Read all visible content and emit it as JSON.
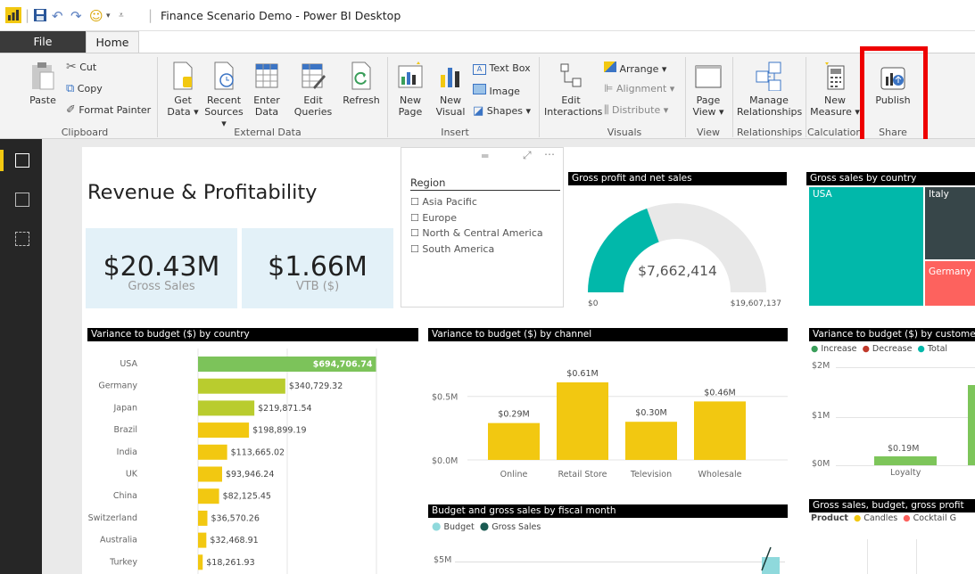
{
  "window": {
    "title": "Finance Scenario Demo - Power BI Desktop"
  },
  "tabs": {
    "file": "File",
    "home": "Home"
  },
  "ribbon": {
    "paste": "Paste",
    "cut": "Cut",
    "copy": "Copy",
    "format_painter": "Format Painter",
    "get_data": [
      "Get",
      "Data ▾"
    ],
    "recent_sources": [
      "Recent",
      "Sources ▾"
    ],
    "enter_data": [
      "Enter",
      "Data"
    ],
    "edit_queries": [
      "Edit",
      "Queries"
    ],
    "refresh": "Refresh",
    "new_page": [
      "New",
      "Page"
    ],
    "new_visual": [
      "New",
      "Visual"
    ],
    "text_box": "Text Box",
    "image": "Image",
    "shapes": "Shapes ▾",
    "edit_interactions": [
      "Edit",
      "Interactions"
    ],
    "arrange": "Arrange ▾",
    "alignment": "Alignment ▾",
    "distribute": "Distribute ▾",
    "page_view": [
      "Page",
      "View ▾"
    ],
    "manage_relationships": [
      "Manage",
      "Relationships"
    ],
    "new_measure": [
      "New",
      "Measure ▾"
    ],
    "publish": "Publish",
    "groups": {
      "clipboard": "Clipboard",
      "external_data": "External Data",
      "insert": "Insert",
      "visuals": "Visuals",
      "view": "View",
      "relationships": "Relationships",
      "calculations": "Calculations",
      "share": "Share"
    }
  },
  "report": {
    "title": "Revenue & Profitability",
    "cards": [
      {
        "value": "$20.43M",
        "label": "Gross Sales"
      },
      {
        "value": "$1.66M",
        "label": "VTB ($)"
      }
    ],
    "slicer": {
      "title": "Region",
      "items": [
        "Asia Pacific",
        "Europe",
        "North & Central America",
        "South America"
      ]
    },
    "gauge": {
      "title": "Gross profit and net sales",
      "value": "$7,662,414",
      "min": "$0",
      "max": "$19,607,137",
      "fraction": 0.39
    },
    "treemap": {
      "title": "Gross sales by country",
      "items": [
        "USA",
        "Italy",
        "Germany"
      ]
    },
    "country_bars": {
      "title": "Variance to budget ($) by country"
    },
    "channel_bars": {
      "title": "Variance to budget ($) by channel"
    },
    "waterfall": {
      "title": "Variance to budget ($) by customer",
      "legend": [
        "Increase",
        "Decrease",
        "Total"
      ],
      "yticks": [
        "$2M",
        "$1M",
        "$0M"
      ],
      "bar_label": "$0.19M",
      "category": "Loyalty"
    },
    "budget_chart": {
      "title": "Budget and gross sales by fiscal month",
      "legend": [
        "Budget",
        "Gross Sales"
      ],
      "ytick": "$5M"
    },
    "gross_chart": {
      "title": "Gross sales, budget, gross profit",
      "legend_label": "Product",
      "legend": [
        "Candles",
        "Cocktail G"
      ]
    }
  },
  "chart_data": [
    {
      "type": "bar",
      "title": "Variance to budget ($) by country",
      "categories": [
        "USA",
        "Germany",
        "Japan",
        "Brazil",
        "India",
        "UK",
        "China",
        "Switzerland",
        "Australia",
        "Turkey"
      ],
      "values": [
        694706.74,
        340729.32,
        219871.54,
        198899.19,
        113665.02,
        93946.24,
        82125.45,
        36570.26,
        32468.91,
        18261.93
      ],
      "labels": [
        "$694,706.74",
        "$340,729.32",
        "$219,871.54",
        "$198,899.19",
        "$113,665.02",
        "$93,946.24",
        "$82,125.45",
        "$36,570.26",
        "$32,468.91",
        "$18,261.93"
      ]
    },
    {
      "type": "bar",
      "title": "Variance to budget ($) by channel",
      "categories": [
        "Online",
        "Retail Store",
        "Television",
        "Wholesale"
      ],
      "values": [
        0.29,
        0.61,
        0.3,
        0.46
      ],
      "labels": [
        "$0.29M",
        "$0.61M",
        "$0.30M",
        "$0.46M"
      ],
      "yticks": [
        "$0.5M",
        "$0.0M"
      ],
      "ylim": [
        0,
        0.65
      ]
    }
  ]
}
